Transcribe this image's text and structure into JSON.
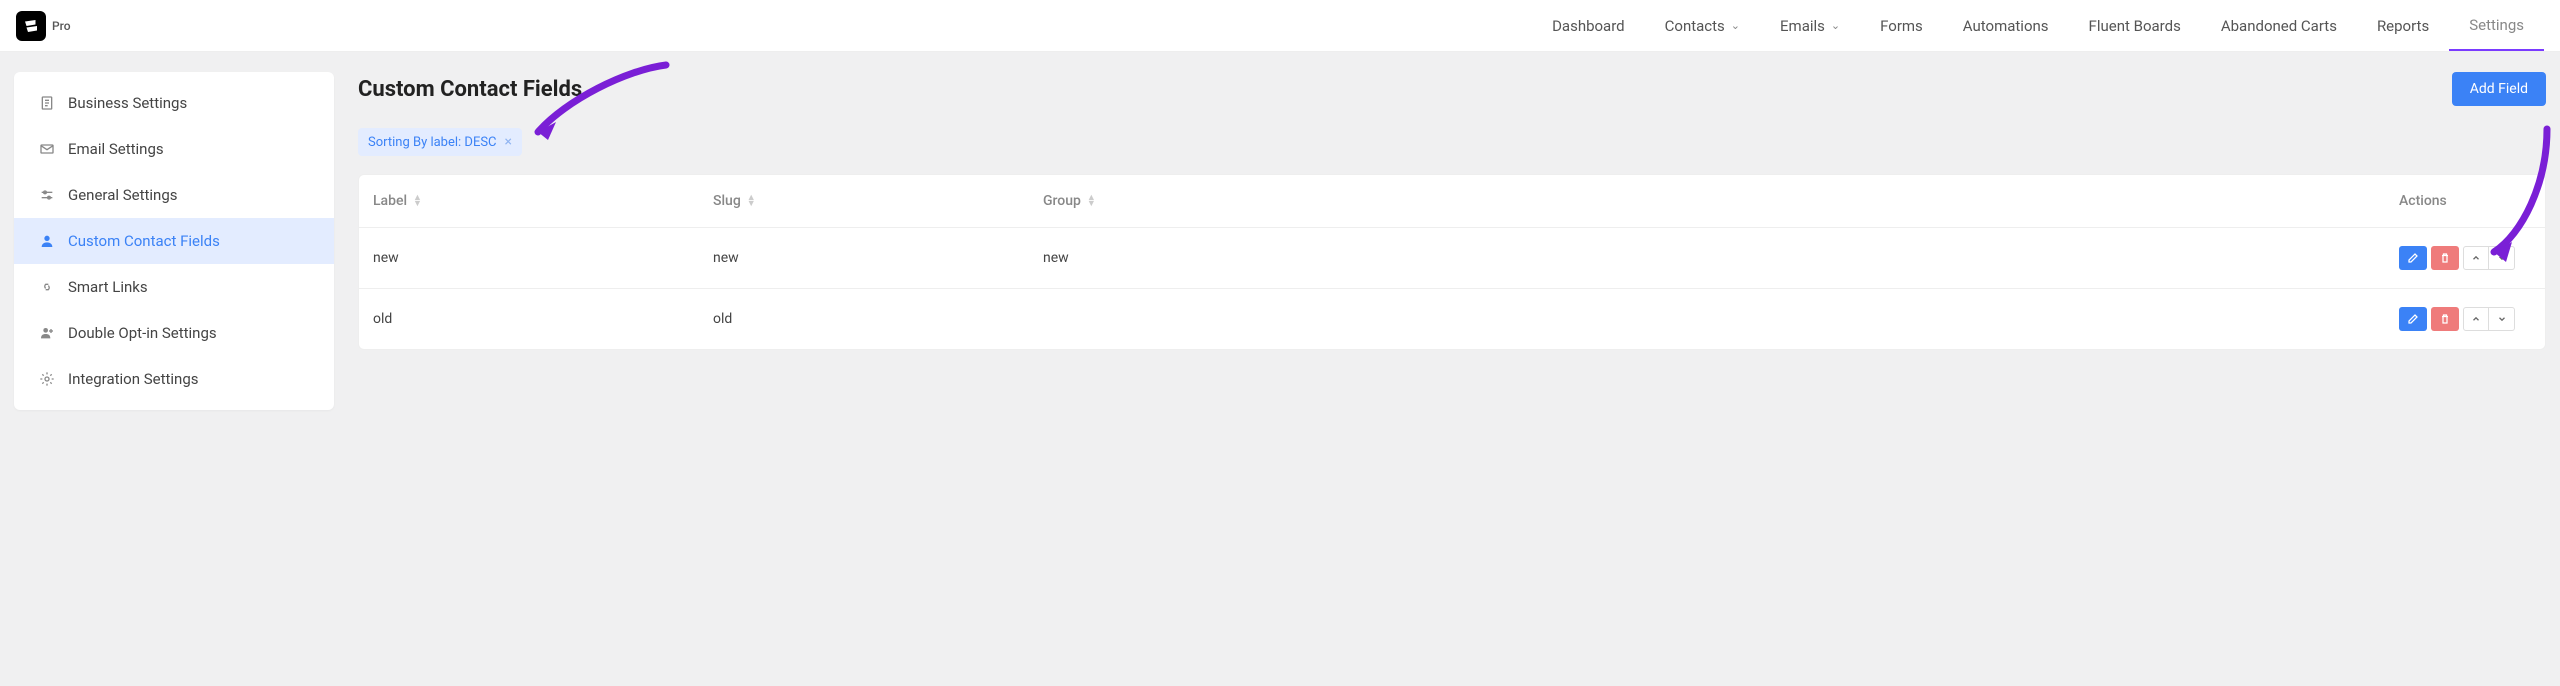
{
  "header": {
    "pro_label": "Pro",
    "nav": {
      "dashboard": "Dashboard",
      "contacts": "Contacts",
      "emails": "Emails",
      "forms": "Forms",
      "automations": "Automations",
      "fluent_boards": "Fluent Boards",
      "abandoned_carts": "Abandoned Carts",
      "reports": "Reports",
      "settings": "Settings"
    }
  },
  "sidebar": {
    "items": {
      "business": "Business Settings",
      "email": "Email Settings",
      "general": "General Settings",
      "custom_fields": "Custom Contact Fields",
      "smart_links": "Smart Links",
      "double_optin": "Double Opt-in Settings",
      "integration": "Integration Settings"
    }
  },
  "page": {
    "title": "Custom Contact Fields",
    "add_button": "Add Field",
    "sort_chip": "Sorting By label: DESC"
  },
  "table": {
    "headers": {
      "label": "Label",
      "slug": "Slug",
      "group": "Group",
      "actions": "Actions"
    },
    "rows": [
      {
        "label": "new",
        "slug": "new",
        "group": "new"
      },
      {
        "label": "old",
        "slug": "old",
        "group": ""
      }
    ]
  }
}
